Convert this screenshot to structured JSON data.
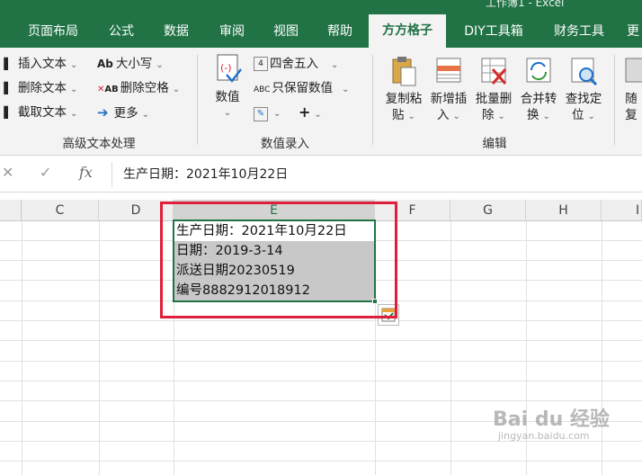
{
  "title_fragment": "工作簿1 - Excel",
  "tabs": [
    {
      "label": "页面布局",
      "active": false
    },
    {
      "label": "公式",
      "active": false
    },
    {
      "label": "数据",
      "active": false
    },
    {
      "label": "审阅",
      "active": false
    },
    {
      "label": "视图",
      "active": false
    },
    {
      "label": "帮助",
      "active": false
    },
    {
      "label": "方方格子",
      "active": true
    },
    {
      "label": "DIY工具箱",
      "active": false
    },
    {
      "label": "财务工具",
      "active": false
    },
    {
      "label": "更",
      "active": false
    }
  ],
  "ribbon": {
    "text_group": {
      "insert_text": "插入文本",
      "delete_text": "删除文本",
      "cut_text": "截取文本",
      "case": "大小写",
      "delete_space": "删除空格",
      "more": "更多",
      "case_icon_text": "Ab",
      "delete_space_icon_text": "AB",
      "label": "高级文本处理"
    },
    "entry_group": {
      "value_btn": "数值",
      "round": "四舍五入",
      "keep_number": "只保留数值",
      "abc_icon_text": "ABC",
      "label": "数值录入"
    },
    "edit_group": {
      "buttons": [
        {
          "line1": "复制粘",
          "line2": "贴"
        },
        {
          "line1": "新增插",
          "line2": "入"
        },
        {
          "line1": "批量删",
          "line2": "除"
        },
        {
          "line1": "合并转",
          "line2": "换"
        },
        {
          "line1": "查找定",
          "line2": "位"
        },
        {
          "line1": "随",
          "line2": "复"
        }
      ],
      "label": "编辑"
    }
  },
  "formula_bar": {
    "cancel": "✕",
    "confirm": "✓",
    "fx": "fx",
    "content": "生产日期：2021年10月22日"
  },
  "columns": [
    "C",
    "D",
    "E",
    "F",
    "G",
    "H",
    "I"
  ],
  "selected_column": "E",
  "cells": [
    "生产日期：2021年10月22日",
    "日期：2019-3-14",
    "派送日期20230519",
    "编号8882912018912"
  ],
  "watermark": {
    "brand": "Bai du 经验",
    "url": "jingyan.baidu.com"
  },
  "colors": {
    "excel_green": "#217346",
    "highlight_red": "#e0203a",
    "selection_shade": "#c8c8c8"
  }
}
